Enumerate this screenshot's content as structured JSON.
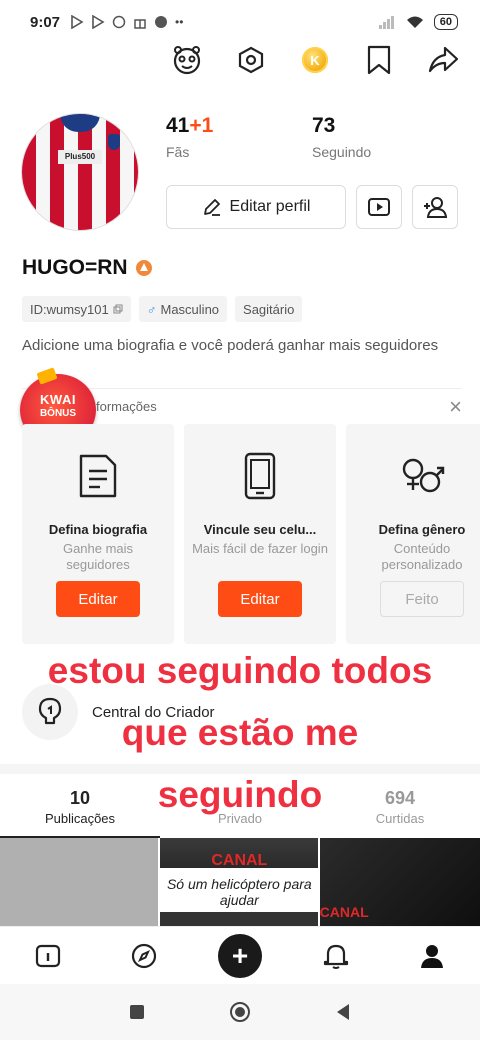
{
  "status_bar": {
    "time": "9:07",
    "battery": "60"
  },
  "profile": {
    "followers_count": "41",
    "followers_new": "+1",
    "followers_label": "Fãs",
    "following_count": "73",
    "following_label": "Seguindo",
    "edit_profile_label": "Editar perfil",
    "avatar_badge": "Plus500",
    "username": "HUGO=RN",
    "tags": {
      "id": "ID:wumsy101",
      "gender": "Masculino",
      "sign": "Sagitário"
    },
    "bio": "Adicione uma biografia e você poderá ganhar mais seguidores"
  },
  "info_section": {
    "title": "formações",
    "kwai_bonus": {
      "line1": "KWAI",
      "line2": "BÔNUS"
    },
    "cards": [
      {
        "title": "Defina biografia",
        "desc": "Ganhe mais seguidores",
        "button": "Editar",
        "icon": "document-icon"
      },
      {
        "title": "Vincule seu celu...",
        "desc": "Mais fácil de fazer  login",
        "button": "Editar",
        "icon": "phone-icon"
      },
      {
        "title": "Defina gênero",
        "desc": "Conteúdo personalizado",
        "button": "Feito",
        "icon": "gender-icon"
      }
    ]
  },
  "creator_center": {
    "label": "Central do Criador"
  },
  "tabs": [
    {
      "count": "10",
      "label": "Publicações",
      "active": true
    },
    {
      "count": "",
      "label": "Privado",
      "active": false
    },
    {
      "count": "694",
      "label": "Curtidas",
      "active": false
    }
  ],
  "grid": {
    "item2_canal": "CANAL",
    "item2_caption": "Só um helicóptero para ajudar",
    "item3_canal": "CANAL"
  },
  "overlay_text": {
    "line1": "estou seguindo todos",
    "line2": "que estão me",
    "line3": "seguindo"
  },
  "colors": {
    "accent": "#fe4c14",
    "overlay": "#ee3040"
  }
}
